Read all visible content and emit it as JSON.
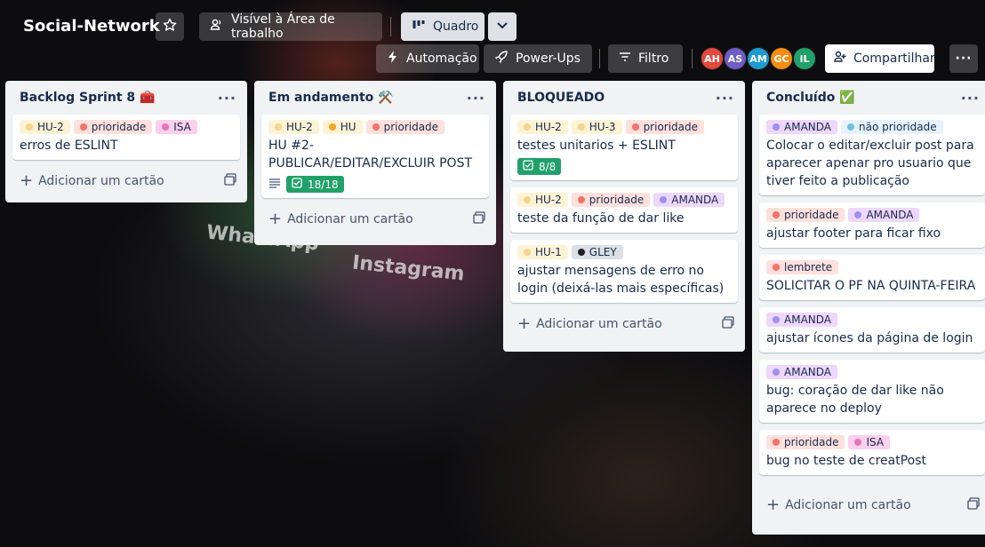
{
  "board": {
    "name": "Social-Network",
    "visibility_label": "Visível à Área de trabalho",
    "view_label": "Quadro",
    "automation_label": "Automação",
    "powerups_label": "Power-Ups",
    "filter_label": "Filtro",
    "share_label": "Compartilhar",
    "members": [
      {
        "initials": "AH",
        "color": "#e2483d"
      },
      {
        "initials": "AS",
        "color": "#6e5dc6"
      },
      {
        "initials": "AM",
        "color": "#1d9bd1"
      },
      {
        "initials": "GC",
        "color": "#f18d13"
      },
      {
        "initials": "IL",
        "color": "#22a06b"
      }
    ]
  },
  "background_words": [
    "WhatsApp",
    "Instagram"
  ],
  "lists": [
    {
      "title": "Backlog Sprint 8 🧰",
      "add_label": "Adicionar um cartão",
      "cards": [
        {
          "labels": [
            "HU-2",
            "prioridade",
            "ISA"
          ],
          "title": "erros de ESLINT"
        }
      ]
    },
    {
      "title": "Em andamento ⚒️",
      "add_label": "Adicionar um cartão",
      "cards": [
        {
          "labels": [
            "HU-2",
            "HU",
            "prioridade"
          ],
          "title": "HU #2- PUBLICAR/EDITAR/EXCLUIR POST",
          "checklist": "18/18"
        }
      ]
    },
    {
      "title": "BLOQUEADO",
      "add_label": "Adicionar um cartão",
      "cards": [
        {
          "labels": [
            "HU-2",
            "HU-3",
            "prioridade"
          ],
          "title": "testes unitarios + ESLINT",
          "checklist": "8/8"
        },
        {
          "labels": [
            "HU-2",
            "prioridade",
            "AMANDA"
          ],
          "title": "teste da função de dar like"
        },
        {
          "labels": [
            "HU-1",
            "GLEY"
          ],
          "title": "ajustar mensagens de erro no login (deixá-las mais específicas)"
        }
      ]
    },
    {
      "title": "Concluído ✅",
      "add_label": "Adicionar um cartão",
      "cards": [
        {
          "labels": [
            "AMANDA",
            "não prioridade"
          ],
          "title": "Colocar o editar/excluir post para aparecer apenar pro usuario que tiver feito a publicação"
        },
        {
          "labels": [
            "prioridade",
            "AMANDA"
          ],
          "title": "ajustar footer para ficar fixo"
        },
        {
          "labels": [
            "lembrete"
          ],
          "title": "SOLICITAR O PF NA QUINTA-FEIRA"
        },
        {
          "labels": [
            "AMANDA"
          ],
          "title": "ajustar ícones da página de login"
        },
        {
          "labels": [
            "AMANDA"
          ],
          "title": "bug: coração de dar like não aparece no deploy"
        },
        {
          "labels": [
            "prioridade",
            "ISA"
          ],
          "title": "bug no teste de creatPost"
        }
      ]
    }
  ]
}
